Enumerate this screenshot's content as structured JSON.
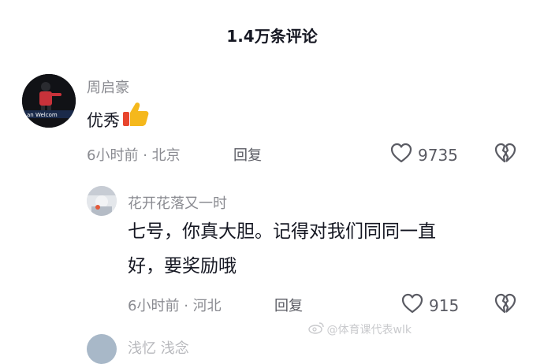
{
  "header": {
    "title": "1.4万条评论"
  },
  "comments": [
    {
      "username": "周启豪",
      "text": "优秀",
      "time": "6小时前",
      "location": "北京",
      "reply_label": "回复",
      "likes": "9735",
      "emoji": "thumbs-up-icon"
    },
    {
      "username": "花开花落又一时",
      "text_line1": "七号，你真大胆。记得对我们同同一直",
      "text_line2": "好，要奖励哦",
      "time": "6小时前",
      "location": "河北",
      "reply_label": "回复",
      "likes": "915"
    }
  ],
  "watermark": {
    "text": "@体育课代表wlk"
  },
  "next_comment": {
    "username_partial": "浅忆 浅念"
  },
  "icons": {
    "like": "heart-outline-icon",
    "dislike": "broken-heart-icon"
  },
  "colors": {
    "text": "#161823",
    "secondary": "#8a8b91",
    "icon": "#5a5b63"
  }
}
